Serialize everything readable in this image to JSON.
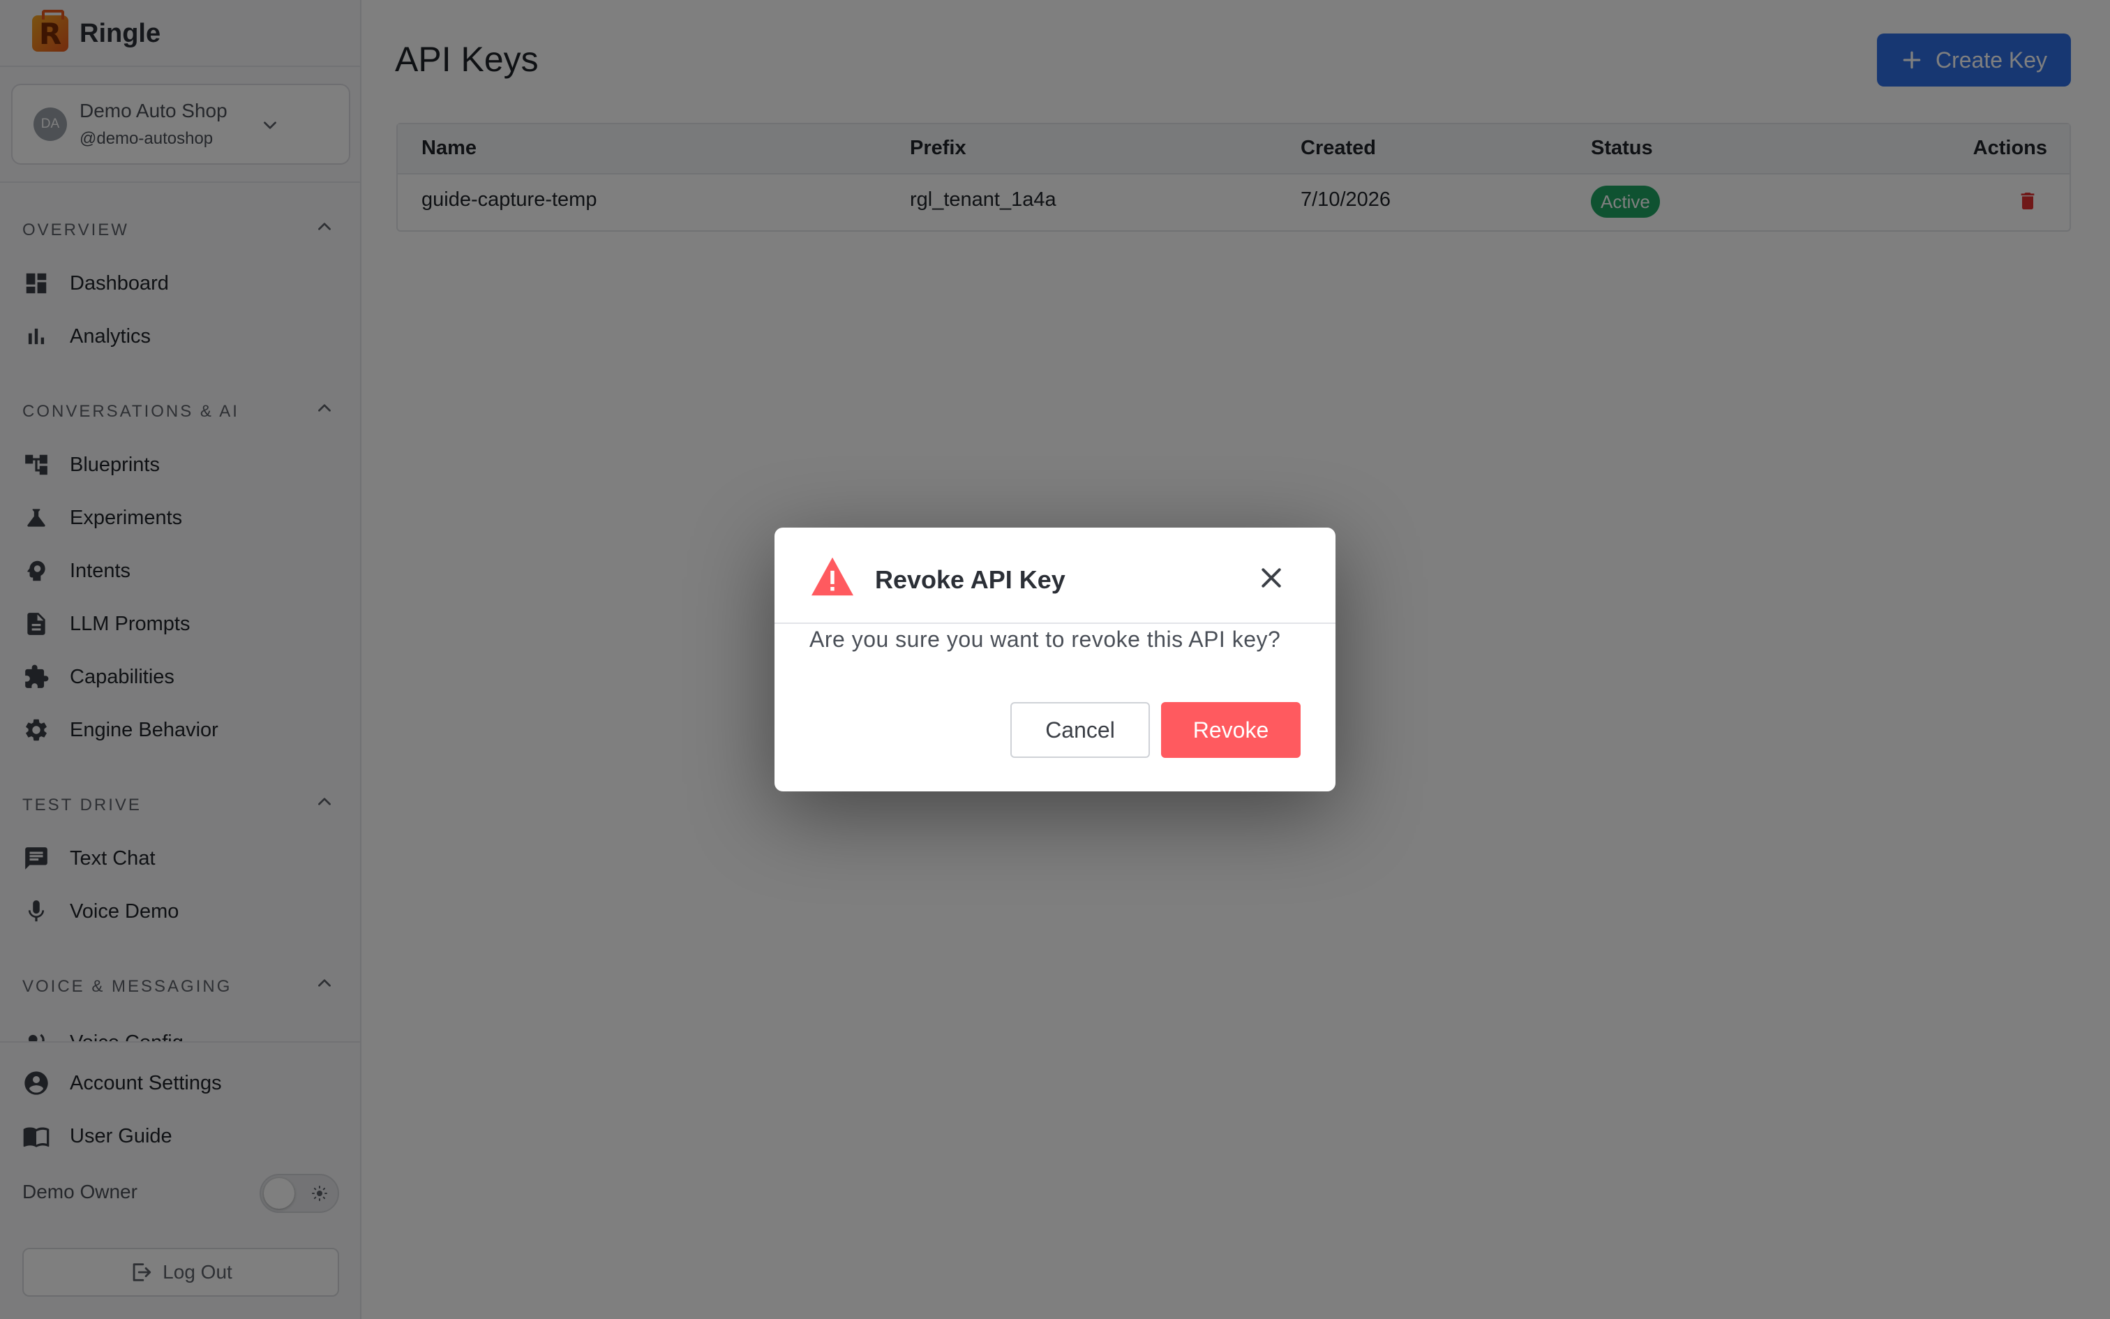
{
  "brand": {
    "logo_letter": "R",
    "name": "Ringle"
  },
  "tenant": {
    "avatar": "DA",
    "name": "Demo Auto Shop",
    "handle": "@demo-autoshop"
  },
  "sidebar": {
    "sections": [
      {
        "label": "OVERVIEW",
        "items": [
          {
            "label": "Dashboard",
            "icon": "dashboard-icon"
          },
          {
            "label": "Analytics",
            "icon": "bar-chart-icon"
          }
        ]
      },
      {
        "label": "CONVERSATIONS & AI",
        "items": [
          {
            "label": "Blueprints",
            "icon": "blueprint-icon"
          },
          {
            "label": "Experiments",
            "icon": "flask-icon"
          },
          {
            "label": "Intents",
            "icon": "head-icon"
          },
          {
            "label": "LLM Prompts",
            "icon": "document-icon"
          },
          {
            "label": "Capabilities",
            "icon": "puzzle-icon"
          },
          {
            "label": "Engine Behavior",
            "icon": "gear-icon"
          }
        ]
      },
      {
        "label": "TEST DRIVE",
        "items": [
          {
            "label": "Text Chat",
            "icon": "chat-icon"
          },
          {
            "label": "Voice Demo",
            "icon": "microphone-icon"
          }
        ]
      },
      {
        "label": "VOICE & MESSAGING",
        "items": [
          {
            "label": "Voice Config",
            "icon": "voice-icon"
          }
        ]
      }
    ],
    "footer": {
      "account_settings": "Account Settings",
      "user_guide": "User Guide",
      "owner": "Demo Owner",
      "logout": "Log Out"
    }
  },
  "main": {
    "title": "API Keys",
    "create_button": "Create Key",
    "table": {
      "columns": [
        "Name",
        "Prefix",
        "Created",
        "Status",
        "Actions"
      ],
      "rows": [
        {
          "name": "guide-capture-temp",
          "prefix": "rgl_tenant_1a4a",
          "created": "7/10/2026",
          "status": "Active"
        }
      ]
    }
  },
  "modal": {
    "title": "Revoke API Key",
    "message": "Are you sure you want to revoke this API key?",
    "cancel": "Cancel",
    "confirm": "Revoke"
  },
  "colors": {
    "accent": "#2f6fe4",
    "danger": "#ff5a5f",
    "success": "#1fa463",
    "overlay": "rgba(0,0,0,0.5)"
  }
}
